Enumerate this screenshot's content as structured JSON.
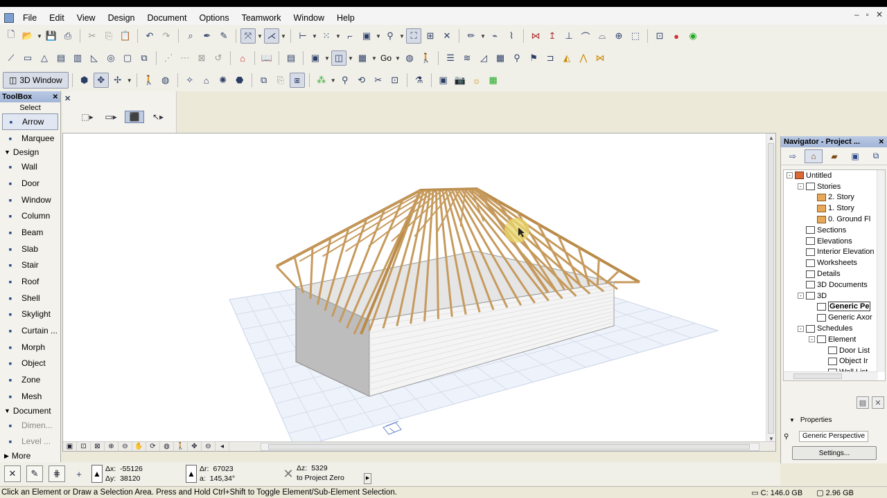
{
  "menu": [
    "File",
    "Edit",
    "View",
    "Design",
    "Document",
    "Options",
    "Teamwork",
    "Window",
    "Help"
  ],
  "toolbar3": {
    "window_label": "3D Window",
    "go_label": "Go"
  },
  "toolbox": {
    "title": "ToolBox",
    "select_label": "Select",
    "select_items": [
      {
        "label": "Arrow",
        "icon": "arrow-icon"
      },
      {
        "label": "Marquee",
        "icon": "marquee-icon"
      }
    ],
    "design_label": "Design",
    "design_items": [
      {
        "label": "Wall",
        "icon": "wall-icon"
      },
      {
        "label": "Door",
        "icon": "door-icon"
      },
      {
        "label": "Window",
        "icon": "window-icon"
      },
      {
        "label": "Column",
        "icon": "column-icon"
      },
      {
        "label": "Beam",
        "icon": "beam-icon"
      },
      {
        "label": "Slab",
        "icon": "slab-icon"
      },
      {
        "label": "Stair",
        "icon": "stair-icon"
      },
      {
        "label": "Roof",
        "icon": "roof-icon"
      },
      {
        "label": "Shell",
        "icon": "shell-icon"
      },
      {
        "label": "Skylight",
        "icon": "skylight-icon"
      },
      {
        "label": "Curtain ...",
        "icon": "curtain-wall-icon"
      },
      {
        "label": "Morph",
        "icon": "morph-icon"
      },
      {
        "label": "Object",
        "icon": "object-icon"
      },
      {
        "label": "Zone",
        "icon": "zone-icon"
      },
      {
        "label": "Mesh",
        "icon": "mesh-icon"
      }
    ],
    "document_label": "Document",
    "document_items": [
      {
        "label": "Dimen...",
        "icon": "dimension-icon"
      },
      {
        "label": "Level ...",
        "icon": "level-icon"
      }
    ],
    "more_label": "More"
  },
  "navigator": {
    "title": "Navigator - Project ...",
    "tree": [
      {
        "label": "Untitled",
        "level": 0,
        "exp": "-",
        "icon": "house",
        "bold": false
      },
      {
        "label": "Stories",
        "level": 1,
        "exp": "-",
        "icon": "plain",
        "bold": false
      },
      {
        "label": "2. Story",
        "level": 2,
        "exp": "",
        "icon": "folder",
        "bold": false
      },
      {
        "label": "1. Story",
        "level": 2,
        "exp": "",
        "icon": "folder",
        "bold": false
      },
      {
        "label": "0. Ground Fl",
        "level": 2,
        "exp": "",
        "icon": "folder",
        "bold": false
      },
      {
        "label": "Sections",
        "level": 1,
        "exp": "",
        "icon": "plain",
        "bold": false
      },
      {
        "label": "Elevations",
        "level": 1,
        "exp": "",
        "icon": "plain",
        "bold": false
      },
      {
        "label": "Interior Elevation",
        "level": 1,
        "exp": "",
        "icon": "plain",
        "bold": false
      },
      {
        "label": "Worksheets",
        "level": 1,
        "exp": "",
        "icon": "plain",
        "bold": false
      },
      {
        "label": "Details",
        "level": 1,
        "exp": "",
        "icon": "plain",
        "bold": false
      },
      {
        "label": "3D Documents",
        "level": 1,
        "exp": "",
        "icon": "plain",
        "bold": false
      },
      {
        "label": "3D",
        "level": 1,
        "exp": "-",
        "icon": "plain",
        "bold": false
      },
      {
        "label": "Generic Pe",
        "level": 2,
        "exp": "",
        "icon": "plain",
        "bold": true
      },
      {
        "label": "Generic Axor",
        "level": 2,
        "exp": "",
        "icon": "plain",
        "bold": false
      },
      {
        "label": "Schedules",
        "level": 1,
        "exp": "-",
        "icon": "plain",
        "bold": false
      },
      {
        "label": "Element",
        "level": 2,
        "exp": "-",
        "icon": "plain",
        "bold": false
      },
      {
        "label": "Door List",
        "level": 3,
        "exp": "",
        "icon": "plain",
        "bold": false
      },
      {
        "label": "Object Ir",
        "level": 3,
        "exp": "",
        "icon": "plain",
        "bold": false
      },
      {
        "label": "Wall List",
        "level": 3,
        "exp": "",
        "icon": "plain",
        "bold": false
      }
    ],
    "properties_label": "Properties",
    "properties_value": "Generic Perspective",
    "settings_label": "Settings..."
  },
  "coords": {
    "dx": "-55126",
    "dy": "38120",
    "dr": "67023",
    "angle": "145,34°",
    "dz": "5329",
    "ref": "to Project Zero",
    "dx_label": "Δx:",
    "dy_label": "Δy:",
    "dr_label": "Δr:",
    "a_label": "a:",
    "dz_label": "Δz:"
  },
  "status": {
    "message": "Click an Element or Draw a Selection Area. Press and Hold Ctrl+Shift to Toggle Element/Sub-Element Selection.",
    "disk": "C: 146.0 GB",
    "memory": "2.96 GB"
  },
  "colors": {
    "panel_header": "#a3b6d8",
    "timber": "#d8b27a",
    "wall": "#f2f2f2",
    "grid": "#dfe6f3"
  }
}
